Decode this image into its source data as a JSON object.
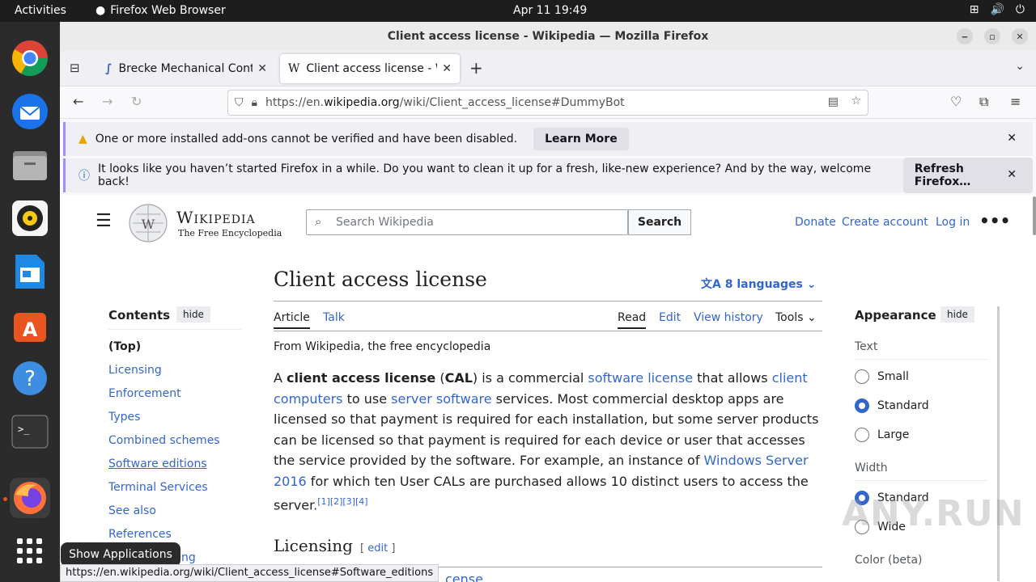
{
  "topbar": {
    "activities": "Activities",
    "app_name": "Firefox Web Browser",
    "clock": "Apr 11  19:49"
  },
  "window": {
    "title": "Client access license - Wikipedia — Mozilla Firefox"
  },
  "tabs": [
    {
      "title": "Brecke Mechanical Contr",
      "favicon": "brecke-icon"
    },
    {
      "title": "Client access license - Wi",
      "favicon": "wikipedia-icon"
    }
  ],
  "url": {
    "prefix": "https://en.",
    "domain": "wikipedia.org",
    "path": "/wiki/Client_access_license#DummyBot"
  },
  "notices": [
    {
      "text": "One or more installed add-ons cannot be verified and have been disabled.",
      "button": "Learn More"
    },
    {
      "text": "It looks like you haven’t started Firefox in a while. Do you want to clean it up for a fresh, like-new experience? And by the way, welcome back!",
      "button": "Refresh Firefox…"
    }
  ],
  "wiki": {
    "logo_title": "Wikipedia",
    "logo_subtitle": "The Free Encyclopedia",
    "search_placeholder": "Search Wikipedia",
    "search_button": "Search",
    "user_links": [
      "Donate",
      "Create account",
      "Log in"
    ],
    "page_title": "Client access license",
    "languages": "8 languages",
    "tabs_left": [
      "Article",
      "Talk"
    ],
    "tabs_right": [
      "Read",
      "Edit",
      "View history",
      "Tools"
    ],
    "from": "From Wikipedia, the free encyclopedia",
    "contents_label": "Contents",
    "hide": "hide",
    "toc": [
      "(Top)",
      "Licensing",
      "Enforcement",
      "Types",
      "Combined schemes",
      "Software editions",
      "Terminal Services",
      "See also",
      "References"
    ],
    "toc_partial": "ng",
    "appearance_label": "Appearance",
    "text_label": "Text",
    "text_options": [
      "Small",
      "Standard",
      "Large"
    ],
    "width_label": "Width",
    "width_options": [
      "Standard",
      "Wide"
    ],
    "color_label": "Color (beta)",
    "section_heading": "Licensing",
    "edit_link": "edit",
    "section_partial": "cense"
  },
  "status_url": "https://en.wikipedia.org/wiki/Client_access_license#Software_editions",
  "tooltip": "Show Applications",
  "watermark": "ANY.RUN"
}
